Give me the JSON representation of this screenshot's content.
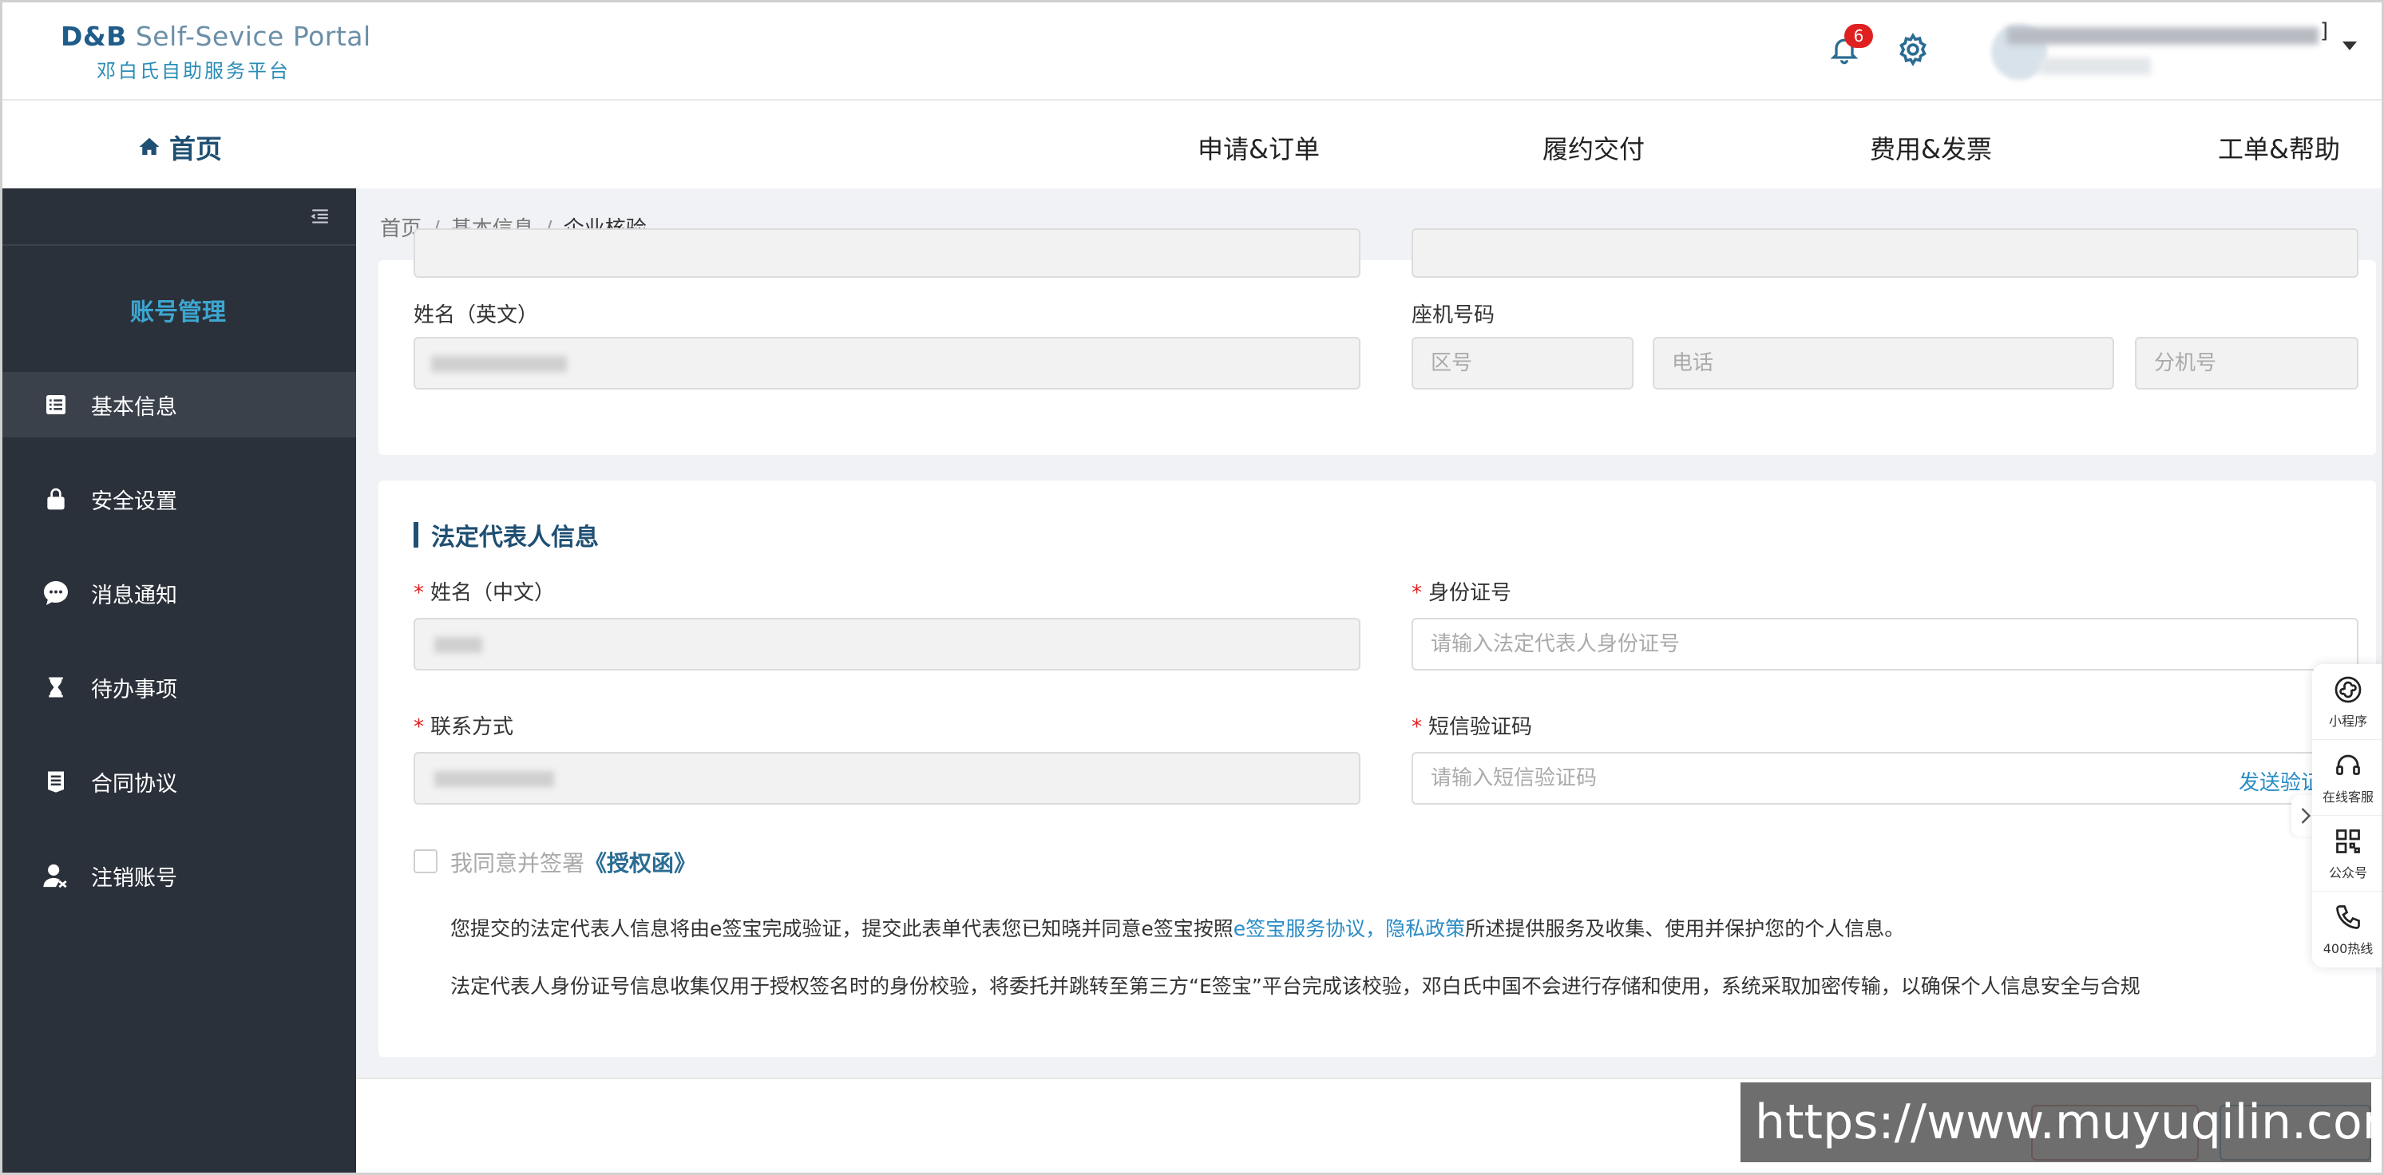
{
  "header": {
    "logo_brand": "D&B",
    "logo_en": "Self-Sevice Portal",
    "logo_cn": "邓白氏自助服务平台",
    "notification_count": "6",
    "user_suffix": "]"
  },
  "nav": {
    "home": "首页",
    "items": [
      "申请&订单",
      "履约交付",
      "费用&发票",
      "工单&帮助"
    ]
  },
  "sidebar": {
    "title": "账号管理",
    "items": [
      {
        "label": "基本信息",
        "icon": "list-icon"
      },
      {
        "label": "安全设置",
        "icon": "lock-icon"
      },
      {
        "label": "消息通知",
        "icon": "chat-icon"
      },
      {
        "label": "待办事项",
        "icon": "hourglass-icon"
      },
      {
        "label": "合同协议",
        "icon": "document-icon"
      },
      {
        "label": "注销账号",
        "icon": "user-remove-icon"
      }
    ]
  },
  "breadcrumb": [
    "首页",
    "基本信息",
    "企业核验"
  ],
  "contact_section": {
    "english_name_label": "姓名（英文）",
    "landline_label": "座机号码",
    "area_code_placeholder": "区号",
    "phone_placeholder": "电话",
    "extension_placeholder": "分机号"
  },
  "legal_rep": {
    "title": "法定代表人信息",
    "name_cn_label": "姓名（中文）",
    "id_label": "身份证号",
    "id_placeholder": "请输入法定代表人身份证号",
    "contact_label": "联系方式",
    "sms_label": "短信验证码",
    "sms_placeholder": "请输入短信验证码",
    "send_code": "发送验证",
    "agree_prefix": "我同意并签署",
    "agree_link": "《授权函》",
    "note1_a": "您提交的法定代表人信息将由e签宝完成验证，提交此表单代表您已知晓并同意e签宝按照",
    "note1_link1": "e签宝服务协议",
    "note1_sep": "，",
    "note1_link2": "隐私政策",
    "note1_b": "所述提供服务及收集、使用并保护您的个人信息。",
    "note2": "法定代表人身份证号信息收集仅用于授权签名时的身份校验，将委托并跳转至第三方“E签宝”平台完成该校验，邓白氏中国不会进行存储和使用，系统采取加密传输，以确保个人信息安全与合规"
  },
  "float_panel": [
    {
      "label": "小程序",
      "icon": "miniprogram-icon"
    },
    {
      "label": "在线客服",
      "icon": "headset-icon"
    },
    {
      "label": "公众号",
      "icon": "qrcode-icon"
    },
    {
      "label": "400热线",
      "icon": "phone-icon"
    }
  ],
  "watermark": "https://www.muyuqilin.com"
}
